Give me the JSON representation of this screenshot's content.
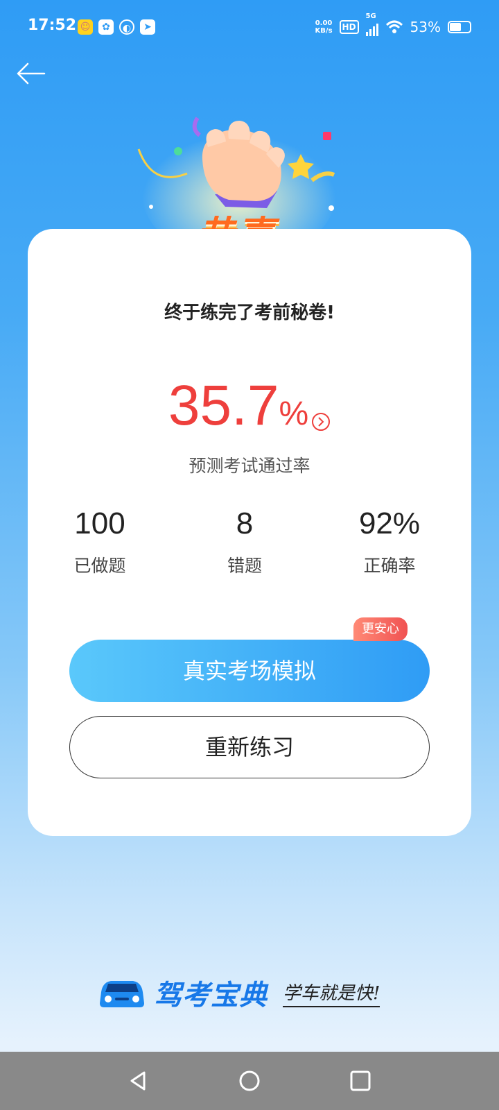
{
  "status_bar": {
    "time": "17:52",
    "net_speed_value": "0.00",
    "net_speed_unit": "KB/s",
    "hd_label": "HD",
    "network_type": "5G",
    "battery_percent": "53%",
    "battery_level": 0.53
  },
  "header": {
    "back_icon": "arrow-left-icon"
  },
  "celebration": {
    "badge_text": "恭喜您!"
  },
  "card": {
    "subtitle": "终于练完了考前秘卷!",
    "pass_rate": {
      "value": "35.7",
      "unit": "%",
      "label": "预测考试通过率"
    },
    "stats": [
      {
        "value": "100",
        "label": "已做题"
      },
      {
        "value": "8",
        "label": "错题"
      },
      {
        "value": "92%",
        "label": "正确率"
      }
    ],
    "primary_button": "真实考场模拟",
    "primary_tag": "更安心",
    "secondary_button": "重新练习"
  },
  "brand": {
    "name": "驾考宝典",
    "slogan": "学车就是快!"
  },
  "colors": {
    "accent": "#2f9cf5",
    "rate_red": "#ee3f3c",
    "brand_blue": "#1778e8"
  }
}
